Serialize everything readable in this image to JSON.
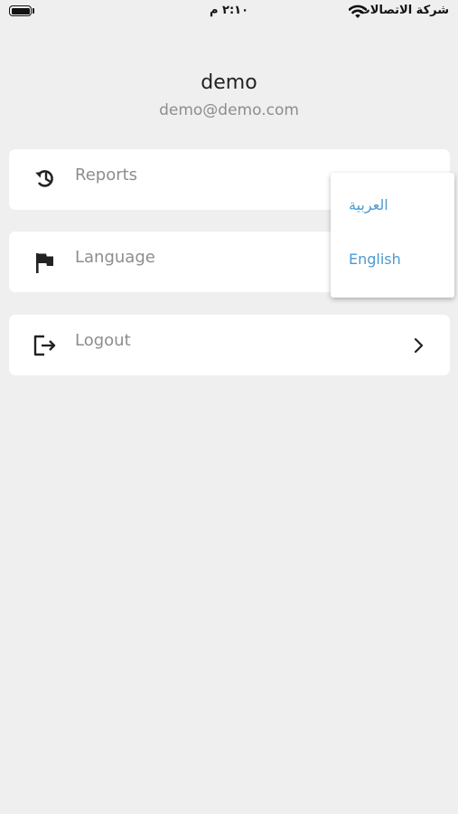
{
  "status_bar": {
    "time": "٢:١٠ م",
    "carrier": "شركة الاتصالات"
  },
  "profile": {
    "name": "demo",
    "email": "demo@demo.com"
  },
  "menu": {
    "items": [
      {
        "label": "Reports",
        "icon": "history-icon"
      },
      {
        "label": "Language",
        "icon": "flag-icon"
      },
      {
        "label": "Logout",
        "icon": "logout-icon"
      }
    ]
  },
  "language_menu": {
    "options": [
      "العربية",
      "English"
    ],
    "accent_color": "#4b9ad3"
  }
}
